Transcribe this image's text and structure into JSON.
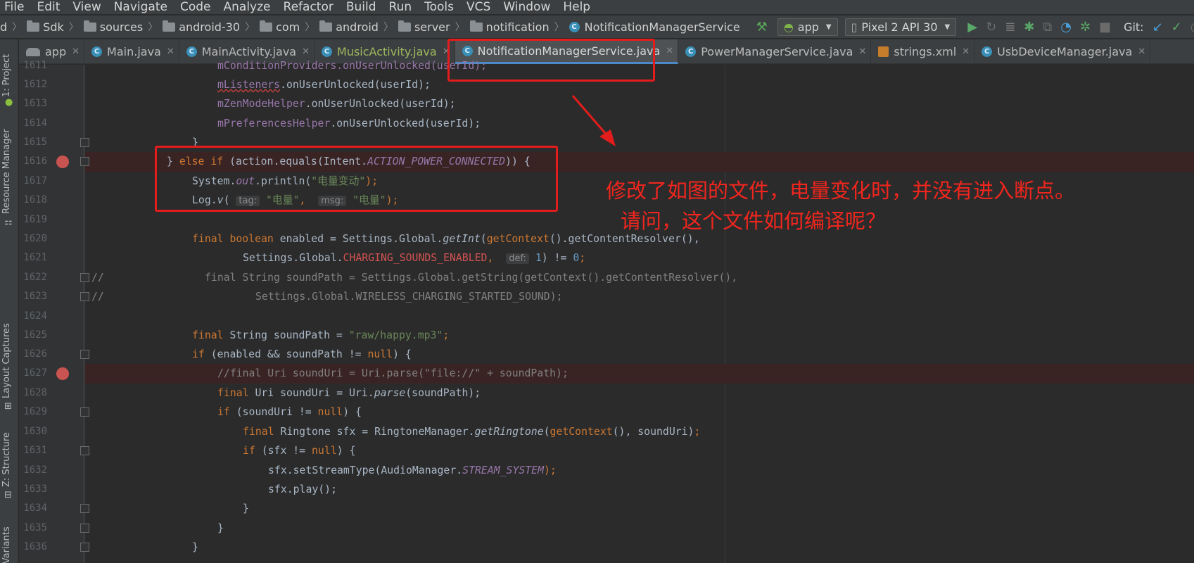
{
  "menu": [
    "File",
    "Edit",
    "View",
    "Navigate",
    "Code",
    "Analyze",
    "Refactor",
    "Build",
    "Run",
    "Tools",
    "VCS",
    "Window",
    "Help"
  ],
  "breadcrumb": {
    "lead": "d",
    "items": [
      "Sdk",
      "sources",
      "android-30",
      "com",
      "android",
      "server",
      "notification"
    ],
    "file": "NotificationManagerService"
  },
  "toolbar": {
    "run_config": "app",
    "device": "Pixel 2 API 30",
    "git_label": "Git:"
  },
  "tool_windows": {
    "project": "1: Project",
    "resource_manager": "Resource Manager",
    "layout_captures": "Layout Captures",
    "structure": "Z: Structure",
    "build_variants": "Build Variants"
  },
  "tabs": [
    {
      "label": "app",
      "icon": "android-icon"
    },
    {
      "label": "Main.java",
      "icon": "java-class-icon"
    },
    {
      "label": "MainActivity.java",
      "icon": "java-class-icon"
    },
    {
      "label": "MusicActivity.java",
      "icon": "java-class-icon"
    },
    {
      "label": "NotificationManagerService.java",
      "icon": "java-class-icon",
      "active": true
    },
    {
      "label": "PowerManagerService.java",
      "icon": "java-class-icon"
    },
    {
      "label": "strings.xml",
      "icon": "xml-icon"
    },
    {
      "label": "UsbDeviceManager.java",
      "icon": "java-class-icon"
    }
  ],
  "line_numbers": [
    "1611",
    "1612",
    "1613",
    "1614",
    "1615",
    "1616",
    "1617",
    "1618",
    "1619",
    "1620",
    "1621",
    "1622",
    "1623",
    "1624",
    "1625",
    "1626",
    "1627",
    "1628",
    "1629",
    "1630",
    "1631",
    "1632",
    "1633",
    "1634",
    "1635",
    "1636"
  ],
  "code": {
    "l1611": "mConditionProviders.onUserUnlocked(userId);",
    "l1612_a": "mListeners",
    "l1612_b": ".onUserUnlocked(userId);",
    "l1613_a": "mZenModeHelper",
    "l1613_b": ".onUserUnlocked(userId);",
    "l1614_a": "mPreferencesHelper",
    "l1614_b": ".onUserUnlocked(userId);",
    "l1615": "}",
    "l1616_a": "} ",
    "l1616_b": "else if",
    "l1616_c": " (action.equals(Intent.",
    "l1616_d": "ACTION_POWER_CONNECTED",
    "l1616_e": ")) {",
    "l1617_a": "System.",
    "l1617_b": "out",
    "l1617_c": ".println(",
    "l1617_d": "\"电量变动\"",
    "l1617_e": ");",
    "l1618_a": "Log.",
    "l1618_b": "v",
    "l1618_c": "( ",
    "l1618_h1": "tag:",
    "l1618_s1": " \"电量\"",
    "l1618_comma": ",  ",
    "l1618_h2": "msg:",
    "l1618_s2": " \"电量\"",
    "l1618_end": ");",
    "l1620_a": "final boolean",
    "l1620_b": " enabled = Settings.Global.",
    "l1620_c": "getInt",
    "l1620_d": "(",
    "l1620_e": "getContext",
    "l1620_f": "().getContentResolver(),",
    "l1621_a": "Settings.Global.",
    "l1621_b": "CHARGING_SOUNDS_ENABLED",
    "l1621_c": ",  ",
    "l1621_h": "def:",
    "l1621_n": " 1",
    "l1621_d": ") != ",
    "l1621_e": "0",
    "l1621_f": ";",
    "l1622_cm": "//",
    "l1622": "final String soundPath = Settings.Global.getString(getContext().getContentResolver(),",
    "l1623_cm": "//",
    "l1623": "Settings.Global.WIRELESS_CHARGING_STARTED_SOUND);",
    "l1625_a": "final",
    "l1625_b": " String soundPath = ",
    "l1625_c": "\"raw/happy.mp3\"",
    "l1625_d": ";",
    "l1626_a": "if",
    "l1626_b": " (enabled && soundPath != ",
    "l1626_c": "null",
    "l1626_d": ") {",
    "l1627": "//final Uri soundUri = Uri.parse(\"file://\" + soundPath);",
    "l1628_a": "final",
    "l1628_b": " Uri soundUri = Uri.",
    "l1628_c": "parse",
    "l1628_d": "(soundPath);",
    "l1629_a": "if",
    "l1629_b": " (soundUri != ",
    "l1629_c": "null",
    "l1629_d": ") {",
    "l1630_a": "final",
    "l1630_b": " Ringtone sfx = RingtoneManager.",
    "l1630_c": "getRingtone",
    "l1630_d": "(",
    "l1630_e": "getContext",
    "l1630_f": "(), soundUri)",
    "l1631_a": "if",
    "l1631_b": " (sfx != ",
    "l1631_c": "null",
    "l1631_d": ") {",
    "l1632_a": "sfx.setStreamType(AudioManager.",
    "l1632_b": "STREAM_SYSTEM",
    "l1632_c": ");",
    "l1633": "sfx.play();",
    "l1634": "}",
    "l1635": "}",
    "l1636": "}"
  },
  "annotation": {
    "line1": "修改了如图的文件，电量变化时，并没有进入断点。",
    "line2": "请问，这个文件如何编译呢？"
  },
  "colors": {
    "annotation_red": "#f0261e",
    "breakpoint": "#c75450",
    "active_tab_underline": "#4a88c7"
  }
}
